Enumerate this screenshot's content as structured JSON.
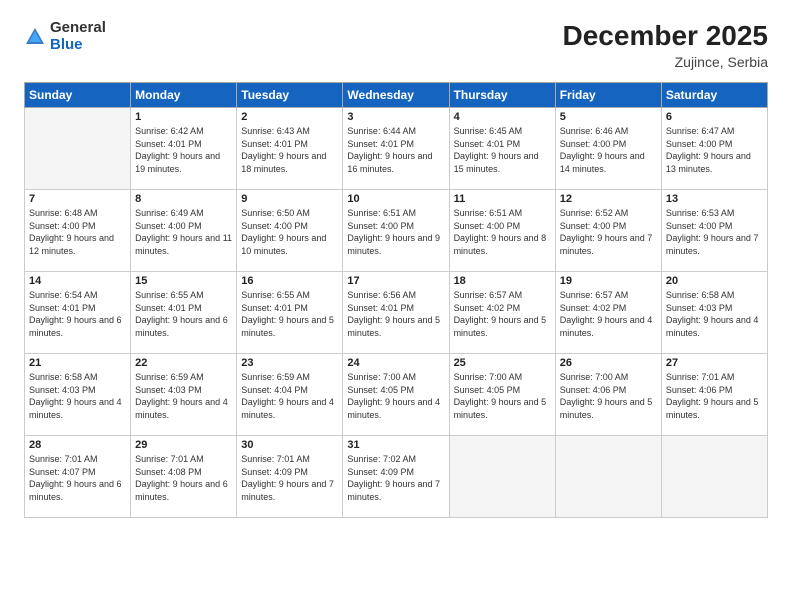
{
  "header": {
    "logo_general": "General",
    "logo_blue": "Blue",
    "month_year": "December 2025",
    "location": "Zujince, Serbia"
  },
  "days_of_week": [
    "Sunday",
    "Monday",
    "Tuesday",
    "Wednesday",
    "Thursday",
    "Friday",
    "Saturday"
  ],
  "weeks": [
    {
      "days": [
        {
          "num": "",
          "empty": true
        },
        {
          "num": "1",
          "sunrise": "6:42 AM",
          "sunset": "4:01 PM",
          "daylight": "9 hours and 19 minutes."
        },
        {
          "num": "2",
          "sunrise": "6:43 AM",
          "sunset": "4:01 PM",
          "daylight": "9 hours and 18 minutes."
        },
        {
          "num": "3",
          "sunrise": "6:44 AM",
          "sunset": "4:01 PM",
          "daylight": "9 hours and 16 minutes."
        },
        {
          "num": "4",
          "sunrise": "6:45 AM",
          "sunset": "4:01 PM",
          "daylight": "9 hours and 15 minutes."
        },
        {
          "num": "5",
          "sunrise": "6:46 AM",
          "sunset": "4:00 PM",
          "daylight": "9 hours and 14 minutes."
        },
        {
          "num": "6",
          "sunrise": "6:47 AM",
          "sunset": "4:00 PM",
          "daylight": "9 hours and 13 minutes."
        }
      ]
    },
    {
      "days": [
        {
          "num": "7",
          "sunrise": "6:48 AM",
          "sunset": "4:00 PM",
          "daylight": "9 hours and 12 minutes."
        },
        {
          "num": "8",
          "sunrise": "6:49 AM",
          "sunset": "4:00 PM",
          "daylight": "9 hours and 11 minutes."
        },
        {
          "num": "9",
          "sunrise": "6:50 AM",
          "sunset": "4:00 PM",
          "daylight": "9 hours and 10 minutes."
        },
        {
          "num": "10",
          "sunrise": "6:51 AM",
          "sunset": "4:00 PM",
          "daylight": "9 hours and 9 minutes."
        },
        {
          "num": "11",
          "sunrise": "6:51 AM",
          "sunset": "4:00 PM",
          "daylight": "9 hours and 8 minutes."
        },
        {
          "num": "12",
          "sunrise": "6:52 AM",
          "sunset": "4:00 PM",
          "daylight": "9 hours and 7 minutes."
        },
        {
          "num": "13",
          "sunrise": "6:53 AM",
          "sunset": "4:00 PM",
          "daylight": "9 hours and 7 minutes."
        }
      ]
    },
    {
      "days": [
        {
          "num": "14",
          "sunrise": "6:54 AM",
          "sunset": "4:01 PM",
          "daylight": "9 hours and 6 minutes."
        },
        {
          "num": "15",
          "sunrise": "6:55 AM",
          "sunset": "4:01 PM",
          "daylight": "9 hours and 6 minutes."
        },
        {
          "num": "16",
          "sunrise": "6:55 AM",
          "sunset": "4:01 PM",
          "daylight": "9 hours and 5 minutes."
        },
        {
          "num": "17",
          "sunrise": "6:56 AM",
          "sunset": "4:01 PM",
          "daylight": "9 hours and 5 minutes."
        },
        {
          "num": "18",
          "sunrise": "6:57 AM",
          "sunset": "4:02 PM",
          "daylight": "9 hours and 5 minutes."
        },
        {
          "num": "19",
          "sunrise": "6:57 AM",
          "sunset": "4:02 PM",
          "daylight": "9 hours and 4 minutes."
        },
        {
          "num": "20",
          "sunrise": "6:58 AM",
          "sunset": "4:03 PM",
          "daylight": "9 hours and 4 minutes."
        }
      ]
    },
    {
      "days": [
        {
          "num": "21",
          "sunrise": "6:58 AM",
          "sunset": "4:03 PM",
          "daylight": "9 hours and 4 minutes."
        },
        {
          "num": "22",
          "sunrise": "6:59 AM",
          "sunset": "4:03 PM",
          "daylight": "9 hours and 4 minutes."
        },
        {
          "num": "23",
          "sunrise": "6:59 AM",
          "sunset": "4:04 PM",
          "daylight": "9 hours and 4 minutes."
        },
        {
          "num": "24",
          "sunrise": "7:00 AM",
          "sunset": "4:05 PM",
          "daylight": "9 hours and 4 minutes."
        },
        {
          "num": "25",
          "sunrise": "7:00 AM",
          "sunset": "4:05 PM",
          "daylight": "9 hours and 5 minutes."
        },
        {
          "num": "26",
          "sunrise": "7:00 AM",
          "sunset": "4:06 PM",
          "daylight": "9 hours and 5 minutes."
        },
        {
          "num": "27",
          "sunrise": "7:01 AM",
          "sunset": "4:06 PM",
          "daylight": "9 hours and 5 minutes."
        }
      ]
    },
    {
      "days": [
        {
          "num": "28",
          "sunrise": "7:01 AM",
          "sunset": "4:07 PM",
          "daylight": "9 hours and 6 minutes."
        },
        {
          "num": "29",
          "sunrise": "7:01 AM",
          "sunset": "4:08 PM",
          "daylight": "9 hours and 6 minutes."
        },
        {
          "num": "30",
          "sunrise": "7:01 AM",
          "sunset": "4:09 PM",
          "daylight": "9 hours and 7 minutes."
        },
        {
          "num": "31",
          "sunrise": "7:02 AM",
          "sunset": "4:09 PM",
          "daylight": "9 hours and 7 minutes."
        },
        {
          "num": "",
          "empty": true
        },
        {
          "num": "",
          "empty": true
        },
        {
          "num": "",
          "empty": true
        }
      ]
    }
  ],
  "labels": {
    "sunrise": "Sunrise:",
    "sunset": "Sunset:",
    "daylight": "Daylight:"
  }
}
